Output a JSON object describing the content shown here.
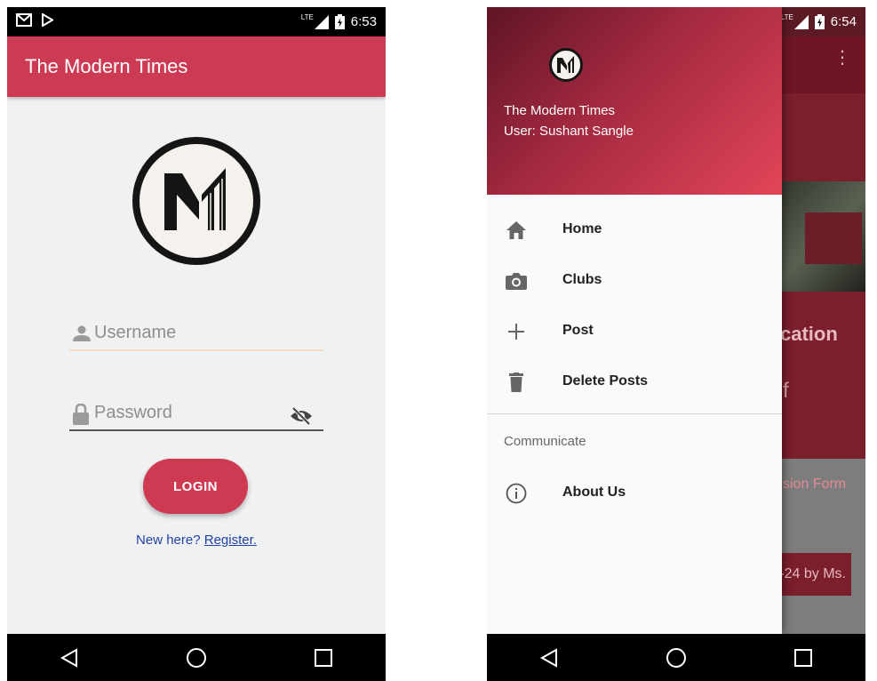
{
  "login_screen": {
    "status": {
      "time": "6:53",
      "network": "LTE"
    },
    "app_title": "The Modern Times",
    "username_placeholder": "Username",
    "password_placeholder": "Password",
    "login_label": "LOGIN",
    "new_here": "New here?",
    "register": "Register."
  },
  "drawer_screen": {
    "status": {
      "time": "6:54",
      "network": "LTE"
    },
    "drawer": {
      "title": "The Modern Times",
      "user": "User: Sushant Sangle",
      "items": [
        {
          "label": "Home",
          "icon": "home-icon"
        },
        {
          "label": "Clubs",
          "icon": "camera-icon"
        },
        {
          "label": "Post",
          "icon": "plus-icon"
        },
        {
          "label": "Delete Posts",
          "icon": "trash-icon"
        }
      ],
      "section": "Communicate",
      "about": {
        "label": "About Us",
        "icon": "info-icon"
      }
    },
    "background": {
      "text1": "cation",
      "text2": "f",
      "text3": "sion Form",
      "text4": "-24 by Ms."
    }
  },
  "colors": {
    "primary": "#cc3b53",
    "accent": "#e24559",
    "link": "#2342a6"
  }
}
